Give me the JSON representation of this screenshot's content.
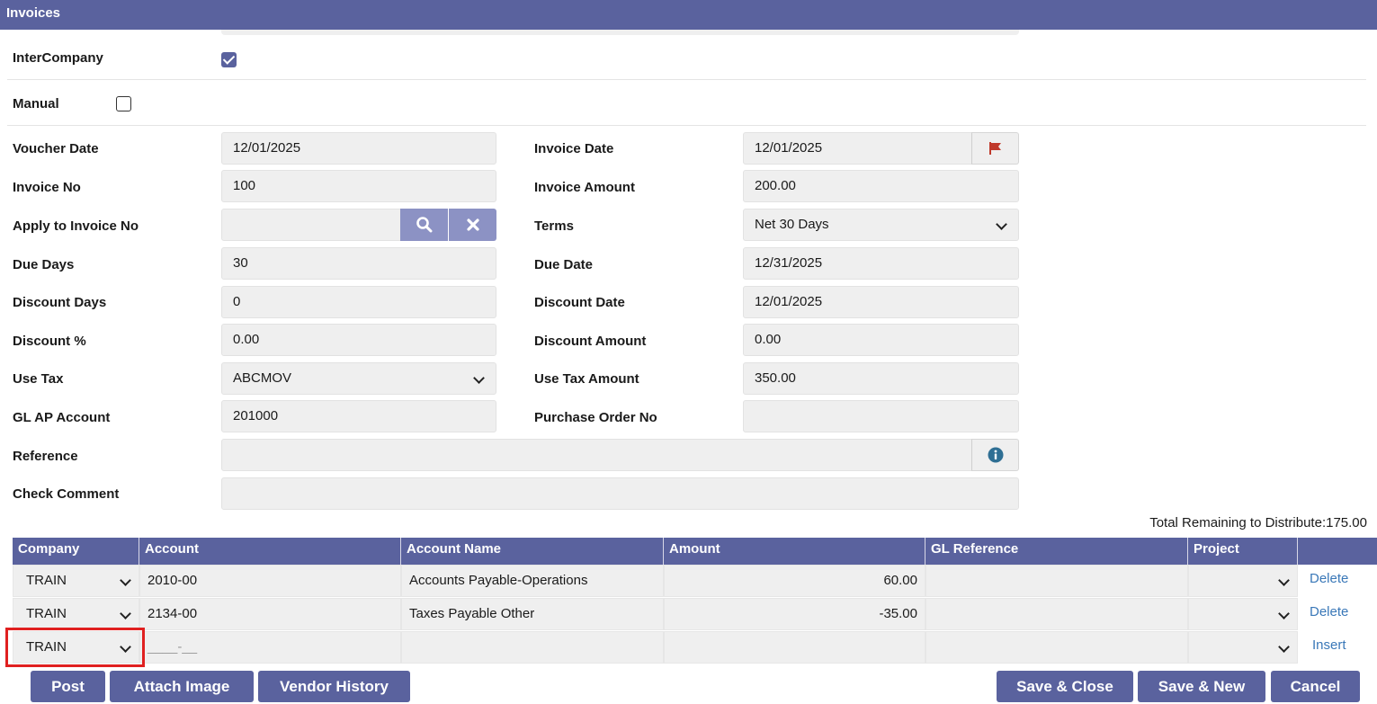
{
  "window": {
    "title": "Invoices"
  },
  "form": {
    "intercompany": {
      "label": "InterCompany",
      "checked": true
    },
    "manual": {
      "label": "Manual",
      "checked": false
    },
    "voucher_date": {
      "label": "Voucher Date",
      "value": "12/01/2025"
    },
    "invoice_date": {
      "label": "Invoice Date",
      "value": "12/01/2025"
    },
    "invoice_no": {
      "label": "Invoice No",
      "value": "100"
    },
    "invoice_amount": {
      "label": "Invoice Amount",
      "value": "200.00"
    },
    "apply_to_invoice_no": {
      "label": "Apply to Invoice No",
      "value": ""
    },
    "terms": {
      "label": "Terms",
      "value": "Net 30 Days"
    },
    "due_days": {
      "label": "Due Days",
      "value": "30"
    },
    "due_date": {
      "label": "Due Date",
      "value": "12/31/2025"
    },
    "discount_days": {
      "label": "Discount Days",
      "value": "0"
    },
    "discount_date": {
      "label": "Discount Date",
      "value": "12/01/2025"
    },
    "discount_pct": {
      "label": "Discount %",
      "value": "0.00"
    },
    "discount_amount": {
      "label": "Discount Amount",
      "value": "0.00"
    },
    "use_tax": {
      "label": "Use Tax",
      "value": "ABCMOV"
    },
    "use_tax_amount": {
      "label": "Use Tax Amount",
      "value": "350.00"
    },
    "gl_ap_account": {
      "label": "GL AP Account",
      "value": "201000"
    },
    "purchase_order_no": {
      "label": "Purchase Order No",
      "value": ""
    },
    "reference": {
      "label": "Reference",
      "value": ""
    },
    "check_comment": {
      "label": "Check Comment",
      "value": ""
    }
  },
  "distribution": {
    "total_remaining": "Total Remaining to Distribute:175.00",
    "columns": [
      "Company",
      "Account",
      "Account Name",
      "Amount",
      "GL Reference",
      "Project",
      ""
    ],
    "rows": [
      {
        "company": "TRAIN",
        "account": "2010-00",
        "account_name": "Accounts Payable-Operations",
        "amount": "60.00",
        "gl_reference": "",
        "project": "",
        "action": "Delete"
      },
      {
        "company": "TRAIN",
        "account": "2134-00",
        "account_name": "Taxes Payable Other",
        "amount": "-35.00",
        "gl_reference": "",
        "project": "",
        "action": "Delete"
      }
    ],
    "new_row": {
      "company": "TRAIN",
      "account_placeholder": "____-__",
      "action": "Insert"
    }
  },
  "buttons": {
    "post": "Post",
    "attach_image": "Attach Image",
    "vendor_history": "Vendor History",
    "save_close": "Save & Close",
    "save_new": "Save & New",
    "cancel": "Cancel"
  },
  "icons": {
    "flag": "flag-icon",
    "search": "search-icon",
    "clear": "close-icon",
    "info": "info-icon"
  },
  "colors": {
    "header": "#5a629e",
    "accent_button": "#8c92c4",
    "link": "#3a78b8",
    "flag": "#c0392b",
    "highlight": "#e02020"
  }
}
